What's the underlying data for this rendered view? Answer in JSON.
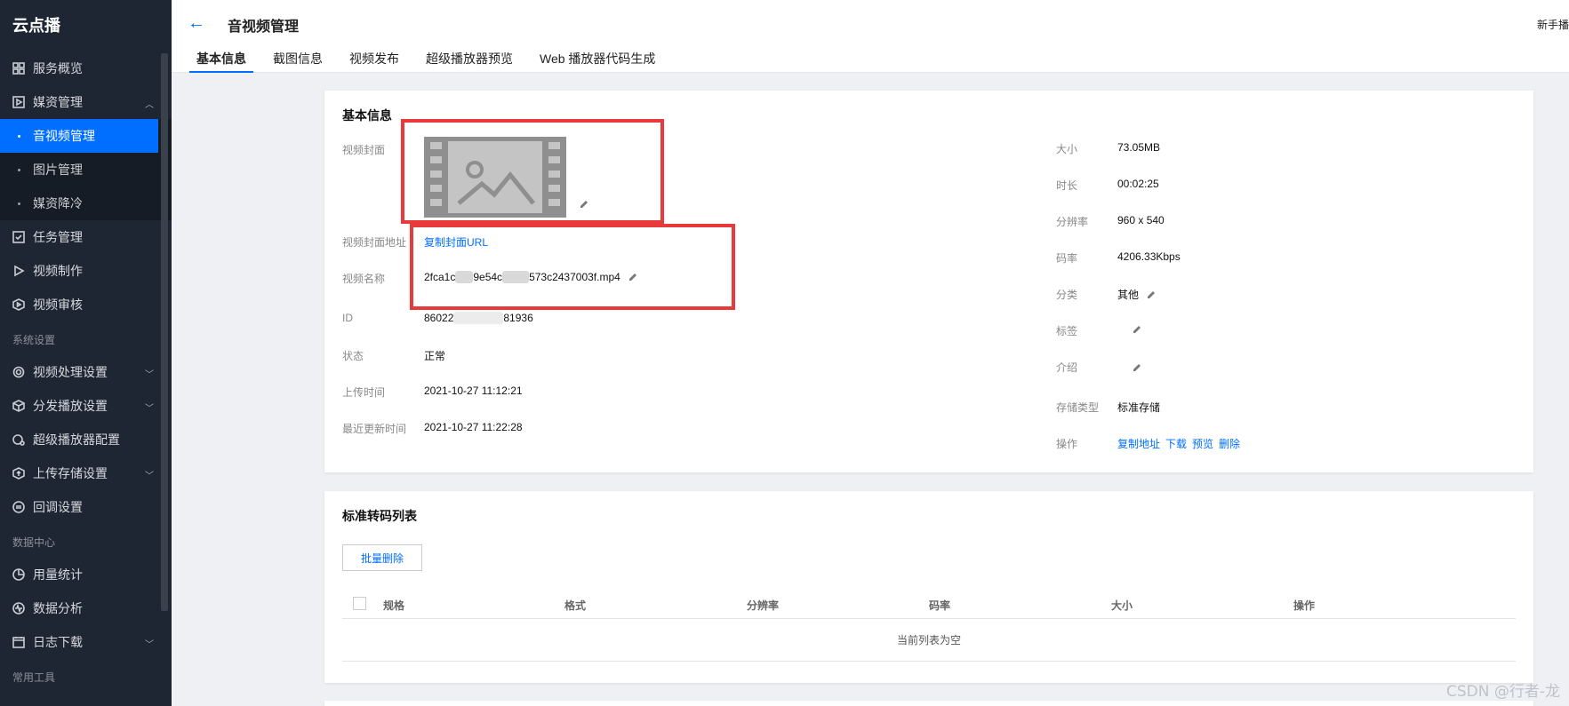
{
  "sidebar": {
    "brand": "云点播",
    "items": [
      {
        "label": "服务概览"
      },
      {
        "label": "媒资管理"
      },
      {
        "label": "任务管理"
      },
      {
        "label": "视频制作"
      },
      {
        "label": "视频审核"
      }
    ],
    "media_sub": [
      {
        "label": "音视频管理"
      },
      {
        "label": "图片管理"
      },
      {
        "label": "媒资降冷"
      }
    ],
    "group_system": "系统设置",
    "system_items": [
      {
        "label": "视频处理设置"
      },
      {
        "label": "分发播放设置"
      },
      {
        "label": "超级播放器配置"
      },
      {
        "label": "上传存储设置"
      },
      {
        "label": "回调设置"
      }
    ],
    "group_data": "数据中心",
    "data_items": [
      {
        "label": "用量统计"
      },
      {
        "label": "数据分析"
      },
      {
        "label": "日志下载"
      }
    ],
    "group_tools": "常用工具"
  },
  "header": {
    "title": "音视频管理",
    "help": "新手播",
    "tabs": [
      {
        "label": "基本信息"
      },
      {
        "label": "截图信息"
      },
      {
        "label": "视频发布"
      },
      {
        "label": "超级播放器预览"
      },
      {
        "label": "Web 播放器代码生成"
      }
    ]
  },
  "info": {
    "title": "基本信息",
    "left": {
      "cover_label": "视频封面",
      "cover_url_label": "视频封面地址",
      "cover_url_link": "复制封面URL",
      "name_label": "视频名称",
      "name_part1": "2fca1c",
      "name_part2": "9e54c",
      "name_part3": "573c2437003f.mp4",
      "id_label": "ID",
      "id_part1": "86022",
      "id_part2": "81936",
      "status_label": "状态",
      "status_value": "正常",
      "upload_label": "上传时间",
      "upload_value": "2021-10-27 11:12:21",
      "updated_label": "最近更新时间",
      "updated_value": "2021-10-27 11:22:28"
    },
    "right": {
      "size_label": "大小",
      "size_value": "73.05MB",
      "duration_label": "时长",
      "duration_value": "00:02:25",
      "resolution_label": "分辨率",
      "resolution_value": "960 x 540",
      "bitrate_label": "码率",
      "bitrate_value": "4206.33Kbps",
      "category_label": "分类",
      "category_value": "其他",
      "tags_label": "标签",
      "intro_label": "介绍",
      "storage_label": "存储类型",
      "storage_value": "标准存储",
      "ops_label": "操作",
      "op_copy": "复制地址",
      "op_download": "下载",
      "op_preview": "预览",
      "op_delete": "删除"
    }
  },
  "transcode": {
    "title": "标准转码列表",
    "batch_delete": "批量删除",
    "columns": [
      "规格",
      "格式",
      "分辨率",
      "码率",
      "大小",
      "操作"
    ],
    "empty": "当前列表为空"
  },
  "watermark": "CSDN @行者-龙",
  "colors": {
    "accent": "#006eff",
    "sidebar": "#1f2633",
    "highlight": "#e8393b"
  }
}
